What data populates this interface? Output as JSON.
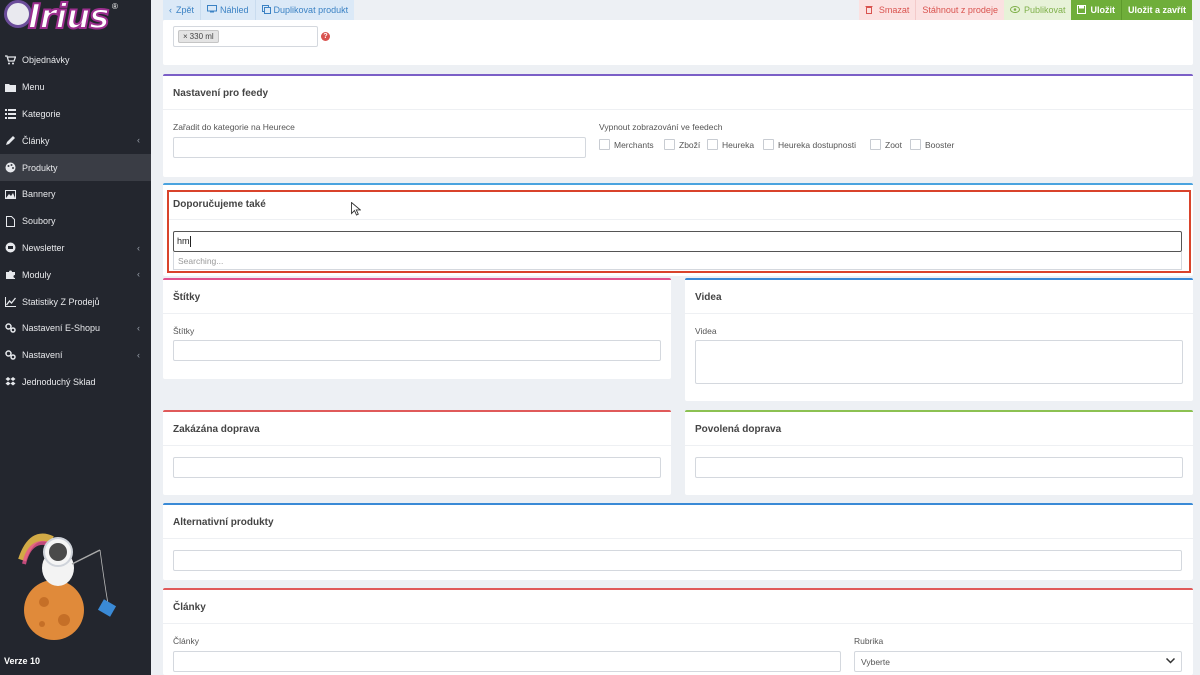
{
  "sidebar": {
    "brand": "Irius",
    "reg": "®",
    "version": "Verze 10",
    "items": [
      {
        "label": "Objednávky",
        "icon": "cart-icon",
        "chevron": false
      },
      {
        "label": "Menu",
        "icon": "folder-icon",
        "chevron": false
      },
      {
        "label": "Kategorie",
        "icon": "list-icon",
        "chevron": false
      },
      {
        "label": "Články",
        "icon": "pencil-icon",
        "chevron": true
      },
      {
        "label": "Produkty",
        "icon": "palette-icon",
        "chevron": false,
        "active": true
      },
      {
        "label": "Bannery",
        "icon": "image-icon",
        "chevron": false
      },
      {
        "label": "Soubory",
        "icon": "file-icon",
        "chevron": false
      },
      {
        "label": "Newsletter",
        "icon": "newsletter-icon",
        "chevron": true
      },
      {
        "label": "Moduly",
        "icon": "puzzle-icon",
        "chevron": true
      },
      {
        "label": "Statistiky Z Prodejů",
        "icon": "chart-icon",
        "chevron": false
      },
      {
        "label": "Nastavení E-Shopu",
        "icon": "cogs-icon",
        "chevron": true
      },
      {
        "label": "Nastavení",
        "icon": "cogs-icon",
        "chevron": true
      },
      {
        "label": "Jednoduchý Sklad",
        "icon": "dropbox-icon",
        "chevron": false
      }
    ]
  },
  "toolbar": {
    "back": "Zpět",
    "preview": "Náhled",
    "duplicate": "Duplikovat produkt",
    "delete": "Smazat",
    "withdraw": "Stáhnout z prodeje",
    "publish": "Publikovat",
    "save": "Uložit",
    "save_close": "Uložit a zavřít"
  },
  "top_field": {
    "tag": "330 ml",
    "tag_remove": "×",
    "help": "?"
  },
  "feeds": {
    "title": "Nastavení pro feedy",
    "category_label": "Zařadit do kategorie na Heurece",
    "disable_label": "Vypnout zobrazování ve feedech",
    "checkboxes": [
      "Merchants",
      "Zboží",
      "Heureka",
      "Heureka dostupnosti",
      "Zoot",
      "Booster"
    ]
  },
  "recommend": {
    "title": "Doporučujeme také",
    "input_value": "hm",
    "searching": "Searching..."
  },
  "tags": {
    "title": "Štítky",
    "label": "Štítky"
  },
  "videos": {
    "title": "Videa",
    "label": "Videa"
  },
  "forbidden_shipping": {
    "title": "Zakázána doprava"
  },
  "allowed_shipping": {
    "title": "Povolená doprava"
  },
  "alternatives": {
    "title": "Alternativní produkty"
  },
  "articles": {
    "title": "Články",
    "label": "Články",
    "rubric_label": "Rubrika",
    "rubric_value": "Vyberte"
  },
  "colors": {
    "sidebar_bg": "#23262e",
    "feeds_accent": "#7b5fc7",
    "recommend_accent": "#4aa3df",
    "recommend_highlight": "#d9432b",
    "tags_accent": "#e0528f",
    "videos_accent": "#3a8ad6",
    "forbidden_accent": "#e05a5a",
    "allowed_accent": "#8cc152",
    "alternatives_accent": "#3a8ad6",
    "articles_accent": "#e05a5a"
  }
}
